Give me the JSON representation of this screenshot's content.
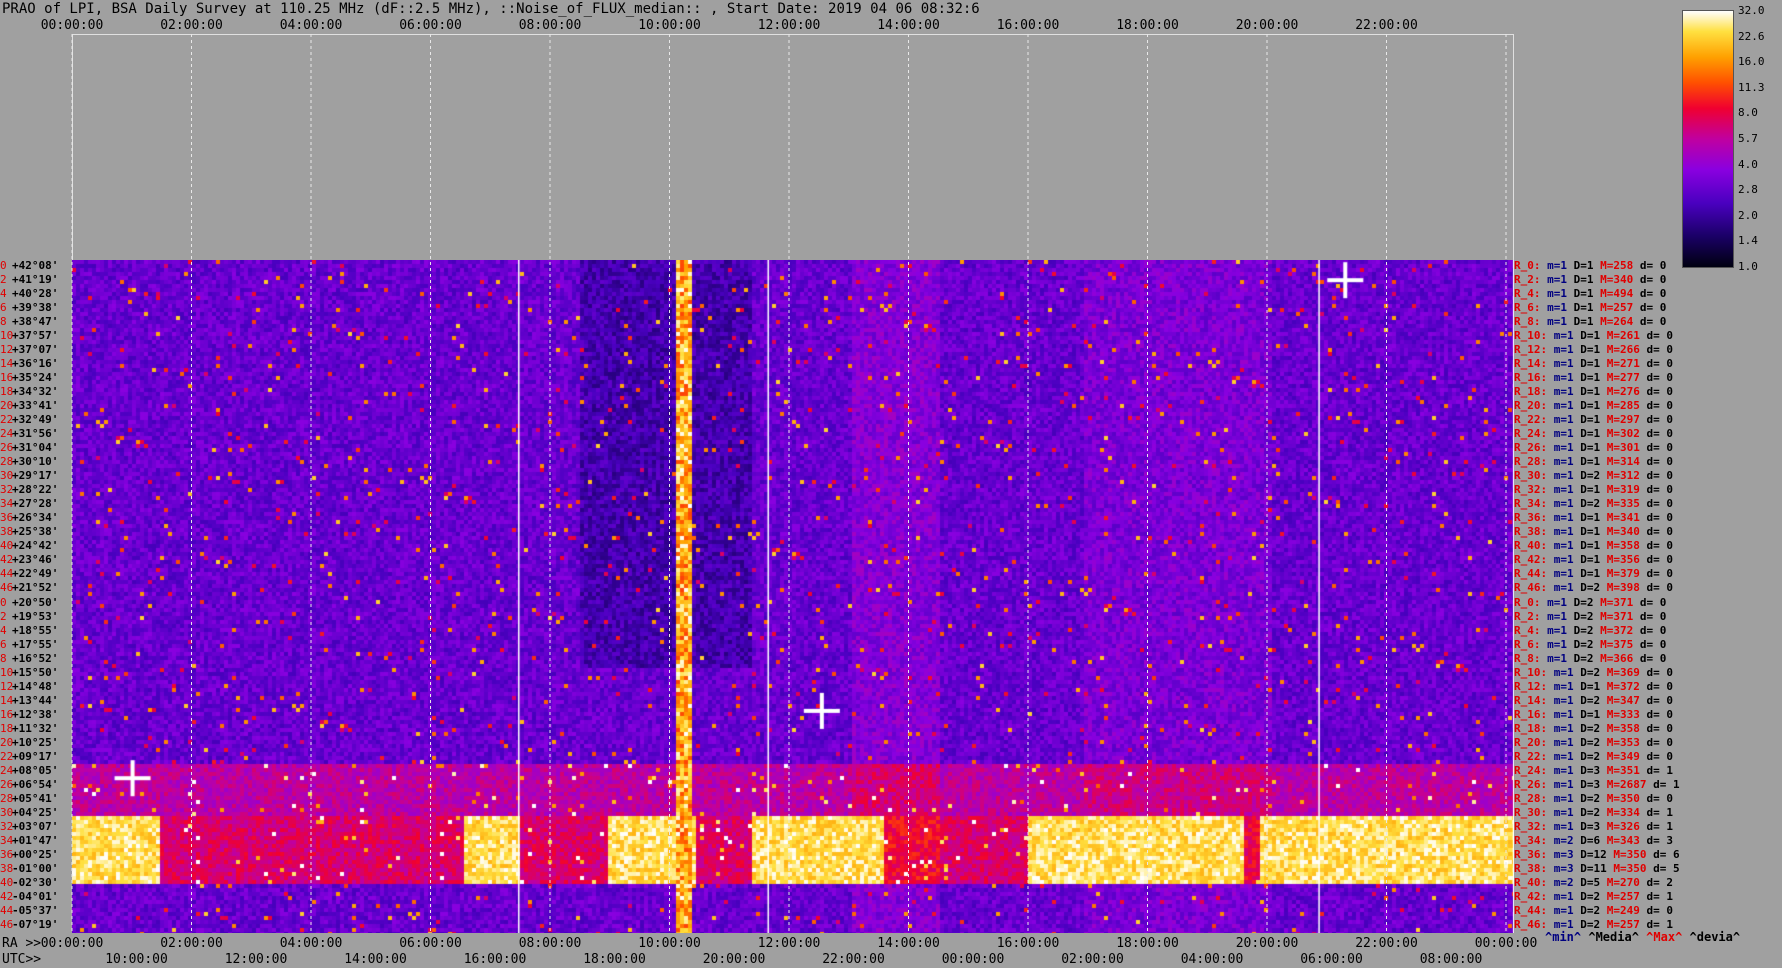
{
  "title": "PRAO of LPI, BSA Daily Survey at 110.25 MHz (dF::2.5 MHz), ::Noise_of_FLUX_median:: , Start Date: 2019 04 06 08:32:6",
  "top_axis_ticks": [
    "00:00:00",
    "02:00:00",
    "04:00:00",
    "06:00:00",
    "08:00:00",
    "10:00:00",
    "12:00:00",
    "14:00:00",
    "16:00:00",
    "18:00:00",
    "20:00:00",
    "22:00:00"
  ],
  "ra_axis": {
    "prefix": "RA >>",
    "ticks": [
      "00:00:00",
      "02:00:00",
      "04:00:00",
      "06:00:00",
      "08:00:00",
      "10:00:00",
      "12:00:00",
      "14:00:00",
      "16:00:00",
      "18:00:00",
      "20:00:00",
      "22:00:00",
      "00:00:00"
    ]
  },
  "utc_axis": {
    "prefix": "UTC>>",
    "ticks": [
      "10:00:00",
      "12:00:00",
      "14:00:00",
      "16:00:00",
      "18:00:00",
      "20:00:00",
      "22:00:00",
      "00:00:00",
      "02:00:00",
      "04:00:00",
      "06:00:00",
      "08:00:00"
    ]
  },
  "colorbar": {
    "ticks": [
      "32.0",
      "22.6",
      "16.0",
      "11.3",
      "8.0",
      "5.7",
      "4.0",
      "2.8",
      "2.0",
      "1.4",
      "1.0"
    ]
  },
  "stats_footer": {
    "min": "^min^",
    "media": "^Media^",
    "max": "^Max^",
    "devia": "^devia^"
  },
  "chart_data": {
    "type": "heatmap",
    "title": "PRAO of LPI, BSA Daily Survey at 110.25 MHz (dF::2.5 MHz), ::Noise_of_FLUX_median:: , Start Date: 2019 04 06 08:32:6",
    "x_axis": "RA 00:00:00 to 24:00:00 (UTC 08:32 to 08:32 next day)",
    "color_scale": {
      "min": 1.0,
      "max": 32.0,
      "scale": "log"
    },
    "rows": [
      {
        "idx": "0",
        "dec": "+42°08'",
        "R": "R_0:",
        "m": "m=1",
        "D": "D=1",
        "M": "M=258",
        "d": "d= 0"
      },
      {
        "idx": "2",
        "dec": "+41°19'",
        "R": "R_2:",
        "m": "m=1",
        "D": "D=1",
        "M": "M=340",
        "d": "d= 0"
      },
      {
        "idx": "4",
        "dec": "+40°28'",
        "R": "R_4:",
        "m": "m=1",
        "D": "D=1",
        "M": "M=494",
        "d": "d= 0"
      },
      {
        "idx": "6",
        "dec": "+39°38'",
        "R": "R_6:",
        "m": "m=1",
        "D": "D=1",
        "M": "M=257",
        "d": "d= 0"
      },
      {
        "idx": "8",
        "dec": "+38°47'",
        "R": "R_8:",
        "m": "m=1",
        "D": "D=1",
        "M": "M=264",
        "d": "d= 0"
      },
      {
        "idx": "10",
        "dec": "+37°57'",
        "R": "R_10:",
        "m": "m=1",
        "D": "D=1",
        "M": "M=261",
        "d": "d= 0"
      },
      {
        "idx": "12",
        "dec": "+37°07'",
        "R": "R_12:",
        "m": "m=1",
        "D": "D=1",
        "M": "M=266",
        "d": "d= 0"
      },
      {
        "idx": "14",
        "dec": "+36°16'",
        "R": "R_14:",
        "m": "m=1",
        "D": "D=1",
        "M": "M=271",
        "d": "d= 0"
      },
      {
        "idx": "16",
        "dec": "+35°24'",
        "R": "R_16:",
        "m": "m=1",
        "D": "D=1",
        "M": "M=277",
        "d": "d= 0"
      },
      {
        "idx": "18",
        "dec": "+34°32'",
        "R": "R_18:",
        "m": "m=1",
        "D": "D=1",
        "M": "M=276",
        "d": "d= 0"
      },
      {
        "idx": "20",
        "dec": "+33°41'",
        "R": "R_20:",
        "m": "m=1",
        "D": "D=1",
        "M": "M=285",
        "d": "d= 0"
      },
      {
        "idx": "22",
        "dec": "+32°49'",
        "R": "R_22:",
        "m": "m=1",
        "D": "D=1",
        "M": "M=297",
        "d": "d= 0"
      },
      {
        "idx": "24",
        "dec": "+31°56'",
        "R": "R_24:",
        "m": "m=1",
        "D": "D=1",
        "M": "M=302",
        "d": "d= 0"
      },
      {
        "idx": "26",
        "dec": "+31°04'",
        "R": "R_26:",
        "m": "m=1",
        "D": "D=1",
        "M": "M=301",
        "d": "d= 0"
      },
      {
        "idx": "28",
        "dec": "+30°10'",
        "R": "R_28:",
        "m": "m=1",
        "D": "D=1",
        "M": "M=314",
        "d": "d= 0"
      },
      {
        "idx": "30",
        "dec": "+29°17'",
        "R": "R_30:",
        "m": "m=1",
        "D": "D=2",
        "M": "M=312",
        "d": "d= 0"
      },
      {
        "idx": "32",
        "dec": "+28°22'",
        "R": "R_32:",
        "m": "m=1",
        "D": "D=1",
        "M": "M=319",
        "d": "d= 0"
      },
      {
        "idx": "34",
        "dec": "+27°28'",
        "R": "R_34:",
        "m": "m=1",
        "D": "D=2",
        "M": "M=335",
        "d": "d= 0"
      },
      {
        "idx": "36",
        "dec": "+26°34'",
        "R": "R_36:",
        "m": "m=1",
        "D": "D=1",
        "M": "M=341",
        "d": "d= 0"
      },
      {
        "idx": "38",
        "dec": "+25°38'",
        "R": "R_38:",
        "m": "m=1",
        "D": "D=1",
        "M": "M=340",
        "d": "d= 0"
      },
      {
        "idx": "40",
        "dec": "+24°42'",
        "R": "R_40:",
        "m": "m=1",
        "D": "D=1",
        "M": "M=358",
        "d": "d= 0"
      },
      {
        "idx": "42",
        "dec": "+23°46'",
        "R": "R_42:",
        "m": "m=1",
        "D": "D=1",
        "M": "M=356",
        "d": "d= 0"
      },
      {
        "idx": "44",
        "dec": "+22°49'",
        "R": "R_44:",
        "m": "m=1",
        "D": "D=1",
        "M": "M=379",
        "d": "d= 0"
      },
      {
        "idx": "46",
        "dec": "+21°52'",
        "R": "R_46:",
        "m": "m=1",
        "D": "D=2",
        "M": "M=398",
        "d": "d= 0"
      },
      {
        "idx": "0",
        "dec": "+20°50'",
        "R": "R_0:",
        "m": "m=1",
        "D": "D=2",
        "M": "M=371",
        "d": "d= 0"
      },
      {
        "idx": "2",
        "dec": "+19°53'",
        "R": "R_2:",
        "m": "m=1",
        "D": "D=2",
        "M": "M=371",
        "d": "d= 0"
      },
      {
        "idx": "4",
        "dec": "+18°55'",
        "R": "R_4:",
        "m": "m=1",
        "D": "D=2",
        "M": "M=372",
        "d": "d= 0"
      },
      {
        "idx": "6",
        "dec": "+17°55'",
        "R": "R_6:",
        "m": "m=1",
        "D": "D=2",
        "M": "M=375",
        "d": "d= 0"
      },
      {
        "idx": "8",
        "dec": "+16°52'",
        "R": "R_8:",
        "m": "m=1",
        "D": "D=2",
        "M": "M=366",
        "d": "d= 0"
      },
      {
        "idx": "10",
        "dec": "+15°50'",
        "R": "R_10:",
        "m": "m=1",
        "D": "D=2",
        "M": "M=369",
        "d": "d= 0"
      },
      {
        "idx": "12",
        "dec": "+14°48'",
        "R": "R_12:",
        "m": "m=1",
        "D": "D=1",
        "M": "M=372",
        "d": "d= 0"
      },
      {
        "idx": "14",
        "dec": "+13°44'",
        "R": "R_14:",
        "m": "m=1",
        "D": "D=2",
        "M": "M=347",
        "d": "d= 0"
      },
      {
        "idx": "16",
        "dec": "+12°38'",
        "R": "R_16:",
        "m": "m=1",
        "D": "D=1",
        "M": "M=333",
        "d": "d= 0"
      },
      {
        "idx": "18",
        "dec": "+11°32'",
        "R": "R_18:",
        "m": "m=1",
        "D": "D=2",
        "M": "M=358",
        "d": "d= 0"
      },
      {
        "idx": "20",
        "dec": "+10°25'",
        "R": "R_20:",
        "m": "m=1",
        "D": "D=2",
        "M": "M=353",
        "d": "d= 0"
      },
      {
        "idx": "22",
        "dec": "+09°17'",
        "R": "R_22:",
        "m": "m=1",
        "D": "D=2",
        "M": "M=349",
        "d": "d= 0"
      },
      {
        "idx": "24",
        "dec": "+08°05'",
        "R": "R_24:",
        "m": "m=1",
        "D": "D=3",
        "M": "M=351",
        "d": "d= 1"
      },
      {
        "idx": "26",
        "dec": "+06°54'",
        "R": "R_26:",
        "m": "m=1",
        "D": "D=3",
        "M": "M=2687",
        "d": "d= 1"
      },
      {
        "idx": "28",
        "dec": "+05°41'",
        "R": "R_28:",
        "m": "m=1",
        "D": "D=2",
        "M": "M=350",
        "d": "d= 0"
      },
      {
        "idx": "30",
        "dec": "+04°25'",
        "R": "R_30:",
        "m": "m=1",
        "D": "D=2",
        "M": "M=334",
        "d": "d= 1"
      },
      {
        "idx": "32",
        "dec": "+03°07'",
        "R": "R_32:",
        "m": "m=1",
        "D": "D=3",
        "M": "M=326",
        "d": "d= 1"
      },
      {
        "idx": "34",
        "dec": "+01°47'",
        "R": "R_34:",
        "m": "m=2",
        "D": "D=6",
        "M": "M=343",
        "d": "d= 3"
      },
      {
        "idx": "36",
        "dec": "+00°25'",
        "R": "R_36:",
        "m": "m=3",
        "D": "D=12",
        "M": "M=350",
        "d": "d= 6"
      },
      {
        "idx": "38",
        "dec": "-01°00'",
        "R": "R_38:",
        "m": "m=3",
        "D": "D=11",
        "M": "M=350",
        "d": "d= 5"
      },
      {
        "idx": "40",
        "dec": "-02°30'",
        "R": "R_40:",
        "m": "m=2",
        "D": "D=5",
        "M": "M=270",
        "d": "d= 2"
      },
      {
        "idx": "42",
        "dec": "-04°01'",
        "R": "R_42:",
        "m": "m=1",
        "D": "D=2",
        "M": "M=257",
        "d": "d= 1"
      },
      {
        "idx": "44",
        "dec": "-05°37'",
        "R": "R_44:",
        "m": "m=1",
        "D": "D=2",
        "M": "M=249",
        "d": "d= 0"
      },
      {
        "idx": "46",
        "dec": "-07°19'",
        "R": "R_46:",
        "m": "m=1",
        "D": "D=2",
        "M": "M=257",
        "d": "d= 1"
      }
    ]
  }
}
